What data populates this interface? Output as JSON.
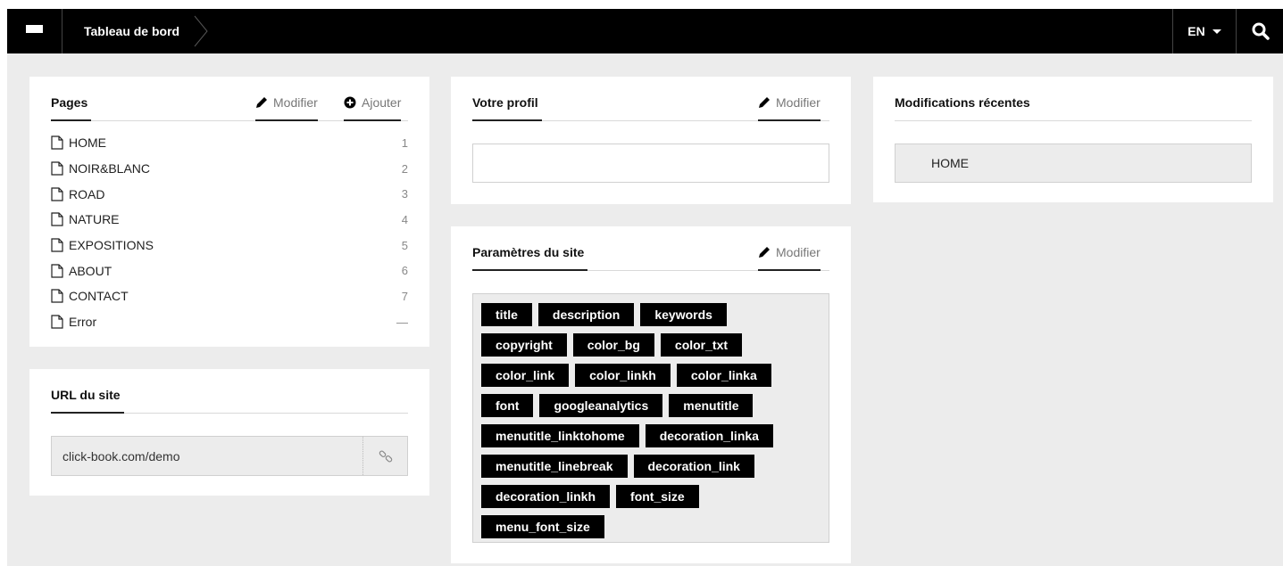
{
  "topbar": {
    "breadcrumb": "Tableau de bord",
    "language": "EN"
  },
  "pages_card": {
    "title": "Pages",
    "edit_label": "Modifier",
    "add_label": "Ajouter",
    "items": [
      {
        "label": "HOME",
        "num": "1"
      },
      {
        "label": "NOIR&BLANC",
        "num": "2"
      },
      {
        "label": "ROAD",
        "num": "3"
      },
      {
        "label": "NATURE",
        "num": "4"
      },
      {
        "label": "EXPOSITIONS",
        "num": "5"
      },
      {
        "label": "ABOUT",
        "num": "6"
      },
      {
        "label": "CONTACT",
        "num": "7"
      },
      {
        "label": "Error",
        "num": "—"
      }
    ]
  },
  "url_card": {
    "title": "URL du site",
    "url": "click-book.com/demo"
  },
  "profile_card": {
    "title": "Votre profil",
    "edit_label": "Modifier"
  },
  "settings_card": {
    "title": "Paramètres du site",
    "edit_label": "Modifier",
    "tag_rows": [
      [
        "title",
        "description",
        "keywords"
      ],
      [
        "copyright",
        "color_bg",
        "color_txt"
      ],
      [
        "color_link",
        "color_linkh",
        "color_linka"
      ],
      [
        "font",
        "googleanalytics",
        "menutitle"
      ],
      [
        "menutitle_linktohome",
        "decoration_linka"
      ],
      [
        "menutitle_linebreak",
        "decoration_link"
      ],
      [
        "decoration_linkh",
        "font_size"
      ],
      [
        "menu_font_size"
      ]
    ]
  },
  "recent_card": {
    "title": "Modifications récentes",
    "items": [
      "HOME"
    ]
  },
  "colors": {
    "topbar_bg": "#000000",
    "page_bg": "#ececec",
    "tag_bg": "#000000"
  },
  "icons": {
    "menu": "hamburger-icon",
    "search": "search-icon",
    "edit": "pencil-icon",
    "add": "plus-circle-icon",
    "page": "file-icon",
    "link": "link-icon"
  }
}
